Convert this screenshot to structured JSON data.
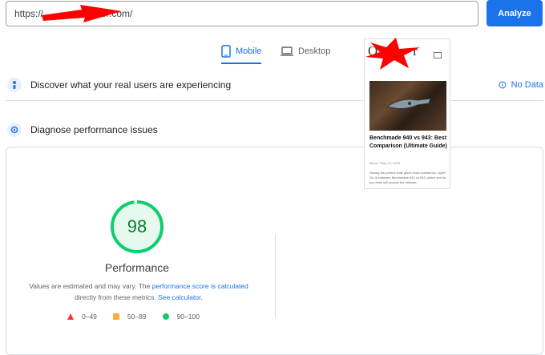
{
  "url_bar": {
    "value": "https://      er.com/",
    "analyze_label": "Analyze"
  },
  "tabs": [
    {
      "label": "Mobile",
      "active": true
    },
    {
      "label": "Desktop",
      "active": false
    }
  ],
  "sections": {
    "discover": {
      "title": "Discover what your real users are experiencing",
      "status": "No Data"
    },
    "diagnose": {
      "title": "Diagnose performance issues"
    }
  },
  "performance": {
    "score": "98",
    "score_fraction": 0.98,
    "label": "Performance",
    "note_prefix": "Values are estimated and may vary. The ",
    "note_link1": "performance score is calculated",
    "note_middle": " directly from these metrics. ",
    "note_link2": "See calculator."
  },
  "legend": [
    {
      "range": "0–49",
      "color": "#ff3333",
      "shape": "triangle"
    },
    {
      "range": "50–89",
      "color": "#ffaa33",
      "shape": "square"
    },
    {
      "range": "90–100",
      "color": "#0cce6b",
      "shape": "circle"
    }
  ],
  "screenshot": {
    "logo_visible": "O",
    "logo_tail": "r",
    "post_title": "Benchmade 940 vs 943: Best Comparison (Ultimate Guide)",
    "post_meta": "Bruce  /  May 13, 2023",
    "post_excerpt": "Having the perfect knife gives extra confidence, right? So, in between Benchmade 940 vs 943, which one do you think will provide the ultimate"
  },
  "colors": {
    "accent": "#1a73e8",
    "good": "#0cce6b",
    "good_text": "#0a7d29",
    "redaction": "#ff0000"
  }
}
